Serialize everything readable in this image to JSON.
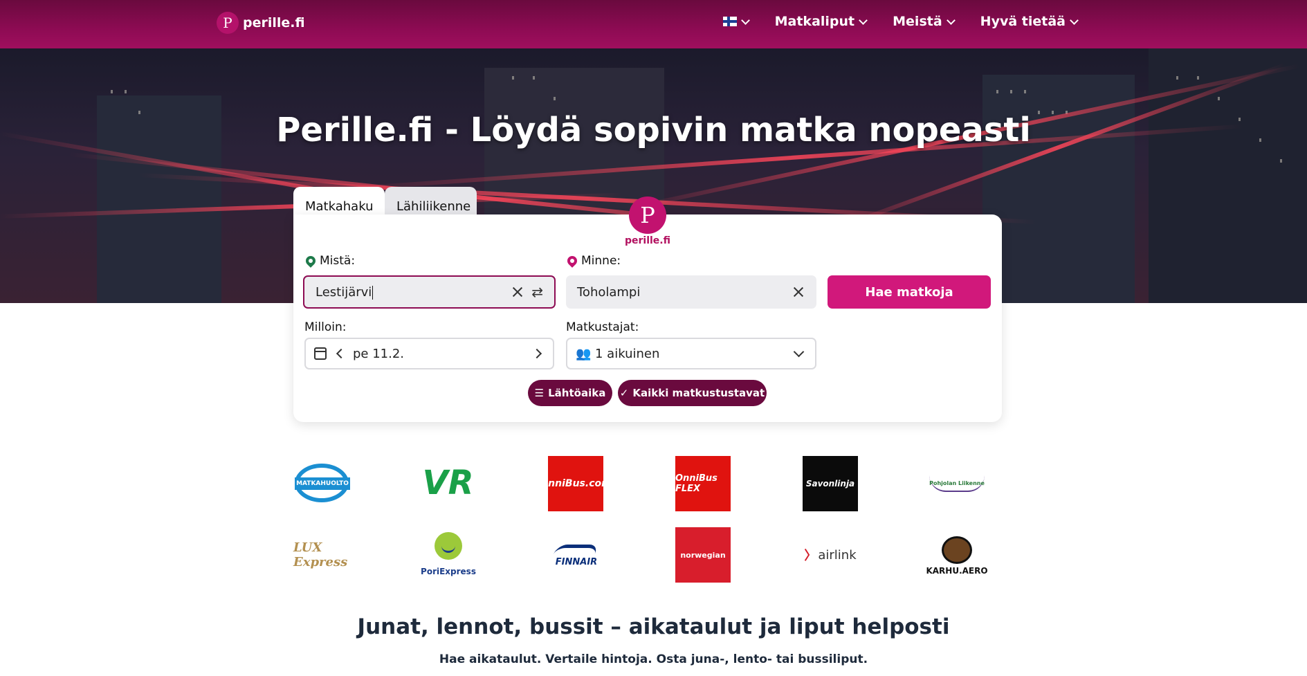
{
  "nav": {
    "brand": "perille.fi",
    "brand_logo_letter": "P",
    "items": [
      {
        "label": "Matkaliput"
      },
      {
        "label": "Meistä"
      },
      {
        "label": "Hyvä tietää"
      }
    ]
  },
  "hero": {
    "title": "Perille.fi - Löydä sopivin matka nopeasti"
  },
  "search": {
    "tabs": [
      {
        "label": "Matkahaku",
        "active": true
      },
      {
        "label": "Lähiliikenne",
        "active": false
      }
    ],
    "center_logo_text": "perille.fi",
    "from_label": "Mistä:",
    "from_value": "Lestijärvi",
    "to_label": "Minne:",
    "to_value": "Toholampi",
    "search_button": "Hae matkoja",
    "date_label": "Milloin:",
    "date_value": "pe 11.2.",
    "travelers_label": "Matkustajat:",
    "travelers_value": "1 aikuinen",
    "sort_pill": "Lähtöaika",
    "modes_pill": "Kaikki matkustustavat"
  },
  "operators": {
    "matkahuolto": "MATKAHUOLTO",
    "vr": "VR",
    "onnibus": "OnniBus.com",
    "onnibusflex": "OnniBus FLEX",
    "savonlinja": "Savonlinja",
    "pohjolan": "Pohjolan Liikenne",
    "lux": "LUX Express",
    "pori": "PoriExpress",
    "finnair": "FINNAIR",
    "norwegian": "norwegian",
    "airlink": "airlink",
    "karhu": "KARHU.AERO"
  },
  "section": {
    "title": "Junat, lennot, bussit – aikataulut ja liput helposti",
    "subtitle": "Hae aikataulut. Vertaile hintoja. Osta juna-, lento- tai bussiliput."
  },
  "colors": {
    "brand": "#8d0b53",
    "accent": "#d1187b",
    "pill": "#6a0a3e"
  }
}
